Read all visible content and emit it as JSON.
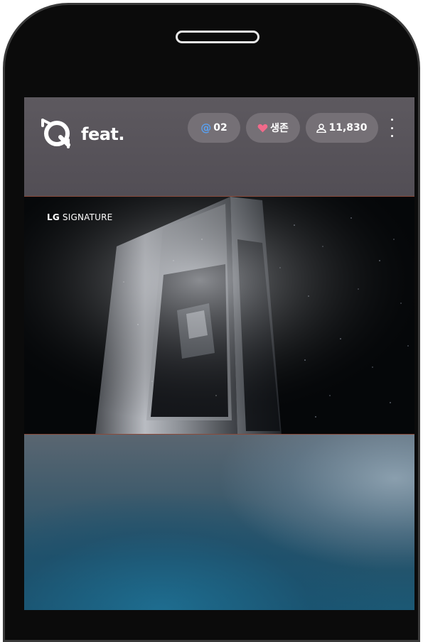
{
  "app": {
    "logo_text": "feat."
  },
  "header": {
    "mention_count": "02",
    "live_label": "생존",
    "viewer_count": "11,830"
  },
  "video": {
    "brand_prefix": "LG",
    "brand_suffix": "SIGNATURE"
  },
  "icons": {
    "mention": "at-icon",
    "live": "heart-icon",
    "viewers": "person-icon",
    "more": "more-vertical-icon"
  },
  "colors": {
    "header_bg": "#5d595f",
    "pill_bg": "#757076",
    "mention_accent": "#5aa0f0",
    "heart": "#f06a8a"
  }
}
